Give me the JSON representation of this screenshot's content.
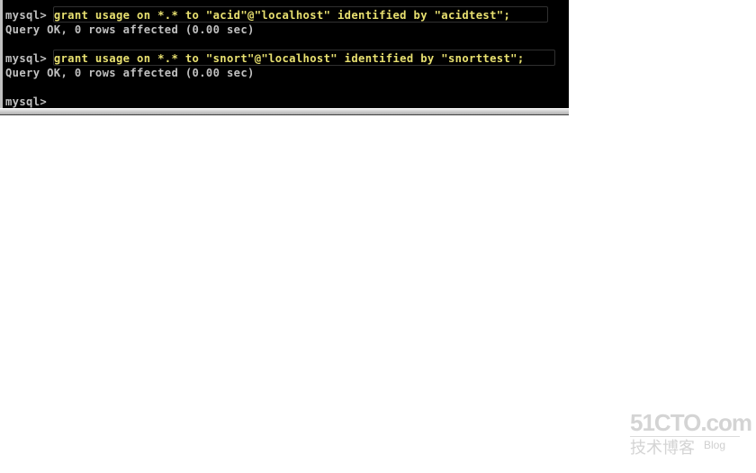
{
  "terminal": {
    "lines": [
      {
        "prompt": "mysql> ",
        "command": "grant usage on *.* to \"acid\"@\"localhost\" identified by \"acidtest\";"
      },
      {
        "output": "Query OK, 0 rows affected (0.00 sec)"
      },
      {
        "prompt": "mysql> ",
        "command": "grant usage on *.* to \"snort\"@\"localhost\" identified by \"snorttest\";"
      },
      {
        "output": "Query OK, 0 rows affected (0.00 sec)"
      },
      {
        "prompt": "mysql>",
        "command": ""
      }
    ],
    "colors": {
      "background": "#000000",
      "prompt": "#c0c0c0",
      "command": "#e8e070",
      "output": "#c0c0c0"
    }
  },
  "watermark": {
    "brand": "51CTO.com",
    "subtitle": "技术博客",
    "blog": "Blog"
  }
}
